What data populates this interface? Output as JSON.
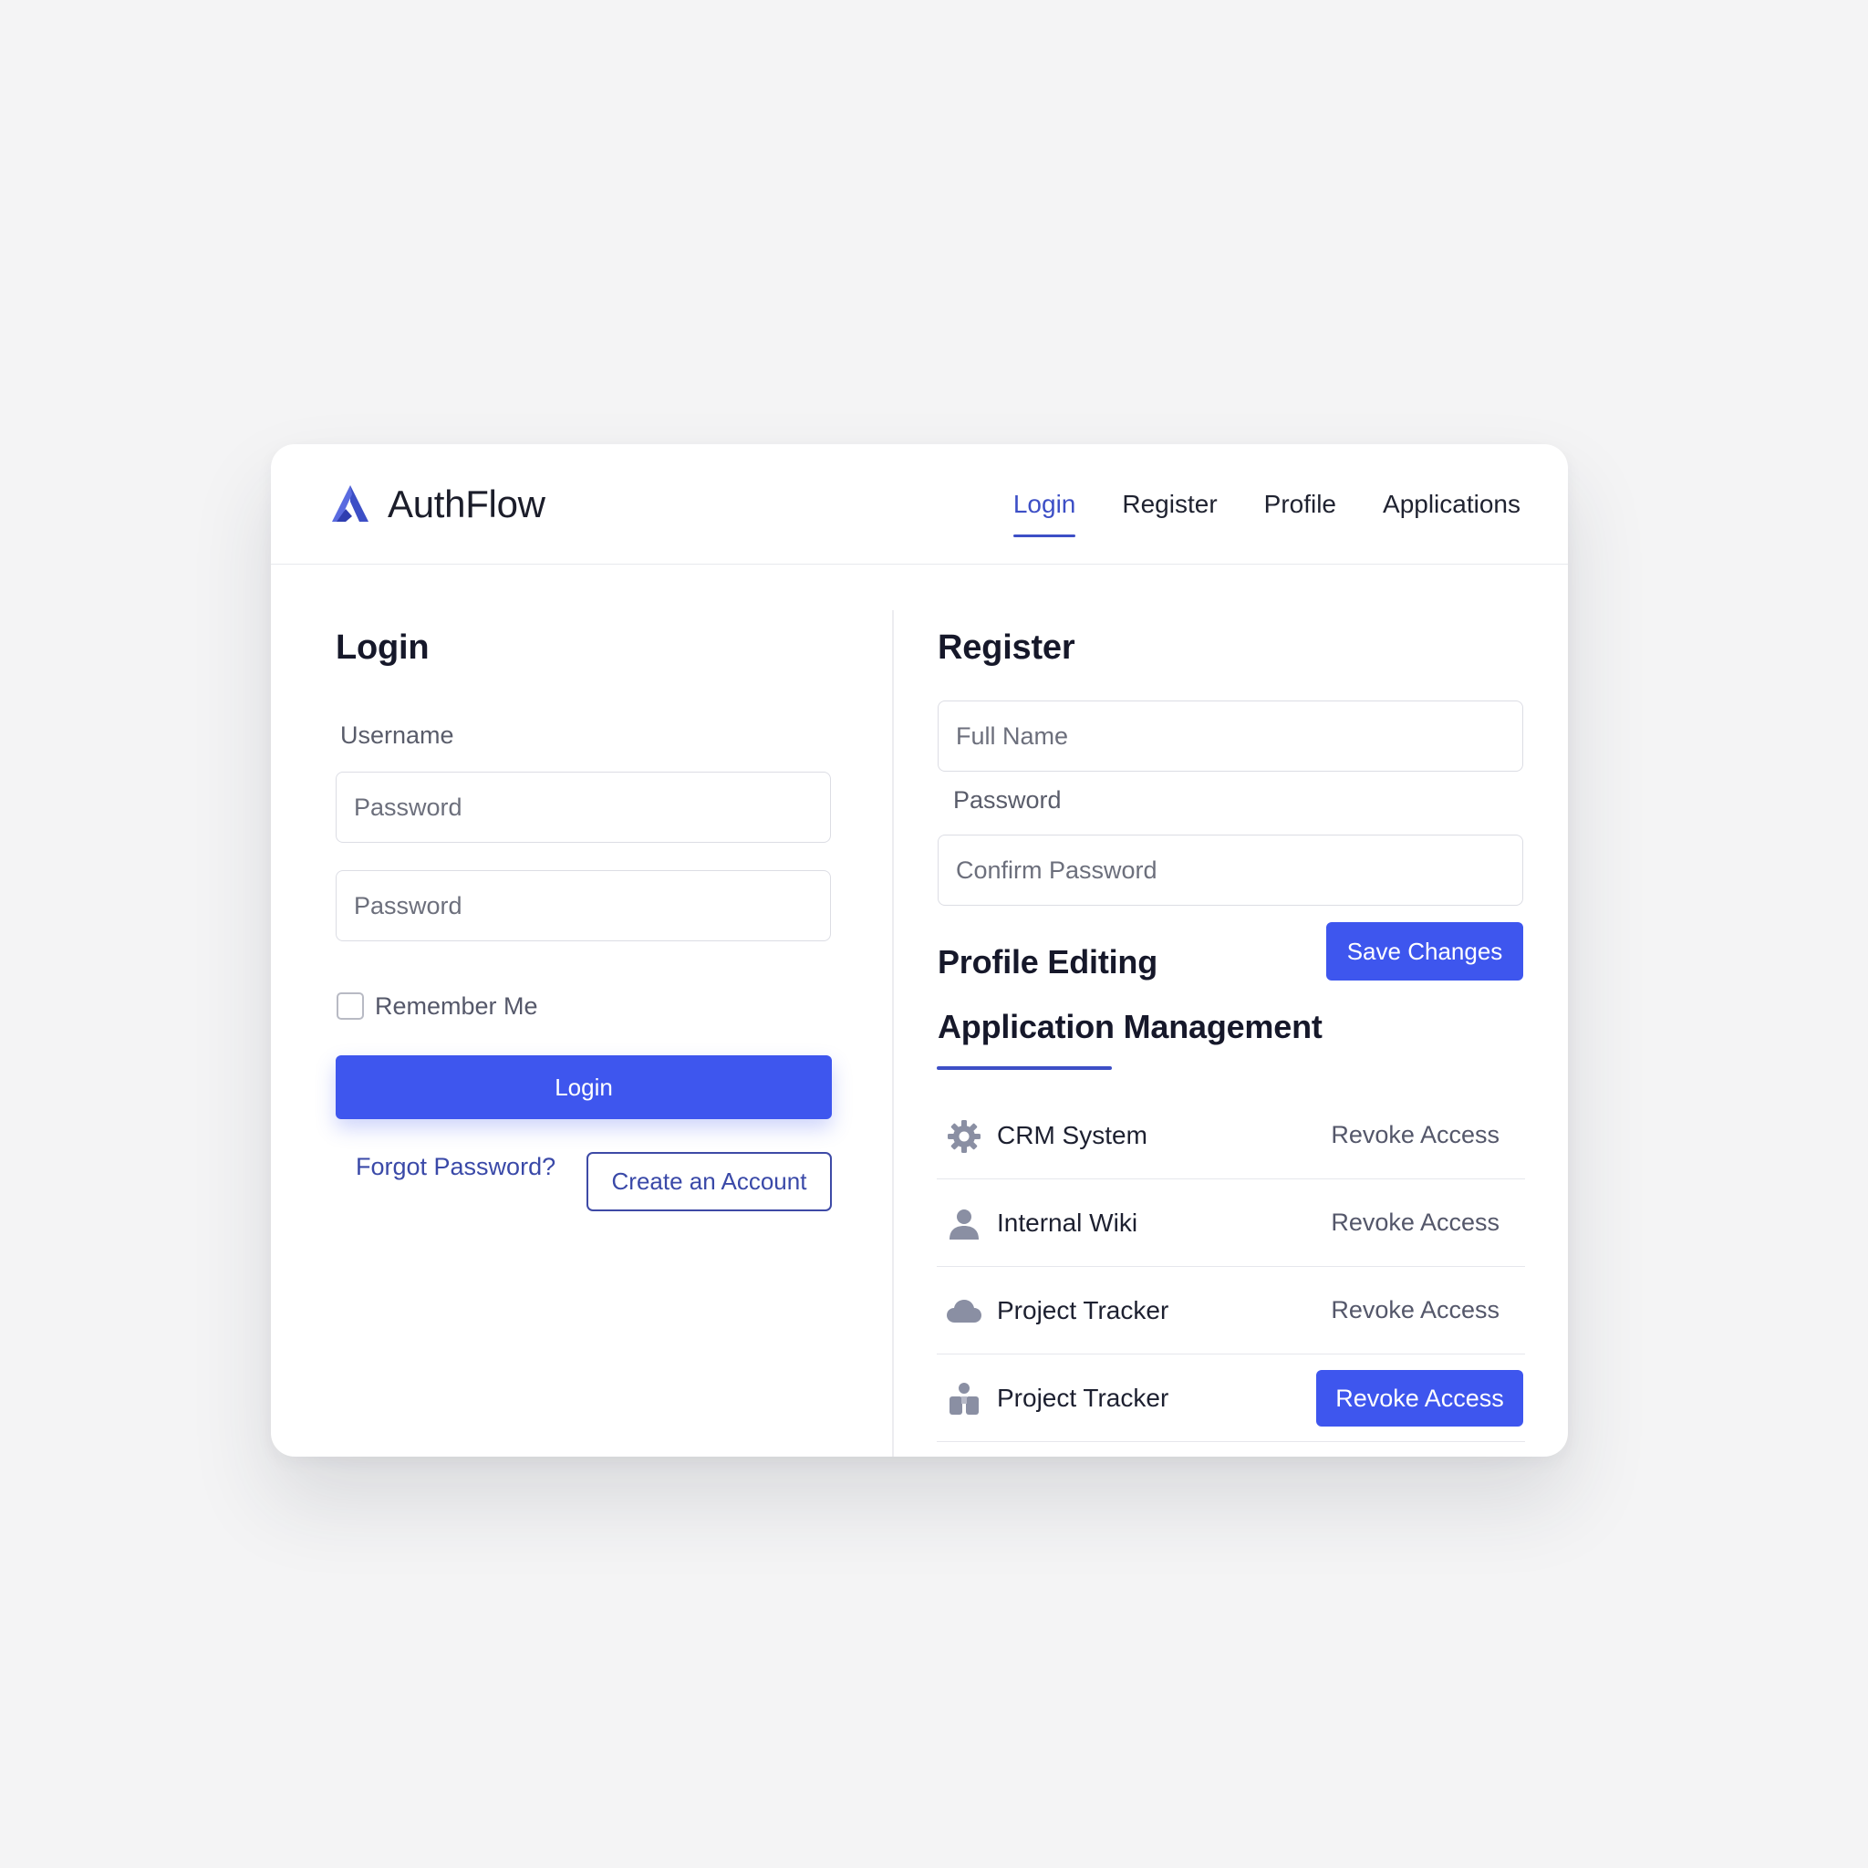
{
  "app": {
    "name": "AuthFlow",
    "logo_icon": "authflow-logo-icon"
  },
  "colors": {
    "accent": "#3e56ee",
    "accent_dark": "#3d4fc6",
    "text": "#1b1d2a",
    "muted": "#595c6a",
    "border": "#dcdde4",
    "background": "#f4f4f5"
  },
  "nav": {
    "active": "Login",
    "tabs": [
      {
        "label": "Login"
      },
      {
        "label": "Register"
      },
      {
        "label": "Profile"
      },
      {
        "label": "Applications"
      }
    ]
  },
  "login": {
    "title": "Login",
    "username_label": "Username",
    "first_field_placeholder": "Password",
    "password_placeholder": "Password",
    "remember_label": "Remember Me",
    "remember_checked": false,
    "submit_label": "Login",
    "forgot_label": "Forgot Password?",
    "create_account_label": "Create an Account"
  },
  "register": {
    "title": "Register",
    "full_name_placeholder": "Full Name",
    "password_label": "Password",
    "confirm_placeholder": "Confirm Password"
  },
  "profile": {
    "title": "Profile Editing",
    "save_label": "Save Changes"
  },
  "applications": {
    "title": "Application Management",
    "items": [
      {
        "name": "CRM System",
        "icon": "gear-icon",
        "action": "Revoke Access",
        "highlighted": false
      },
      {
        "name": "Internal Wiki",
        "icon": "user-icon",
        "action": "Revoke Access",
        "highlighted": false
      },
      {
        "name": "Project Tracker",
        "icon": "cloud-icon",
        "action": "Revoke Access",
        "highlighted": false
      },
      {
        "name": "Project Tracker",
        "icon": "team-icon",
        "action": "Revoke Access",
        "highlighted": true
      }
    ]
  }
}
